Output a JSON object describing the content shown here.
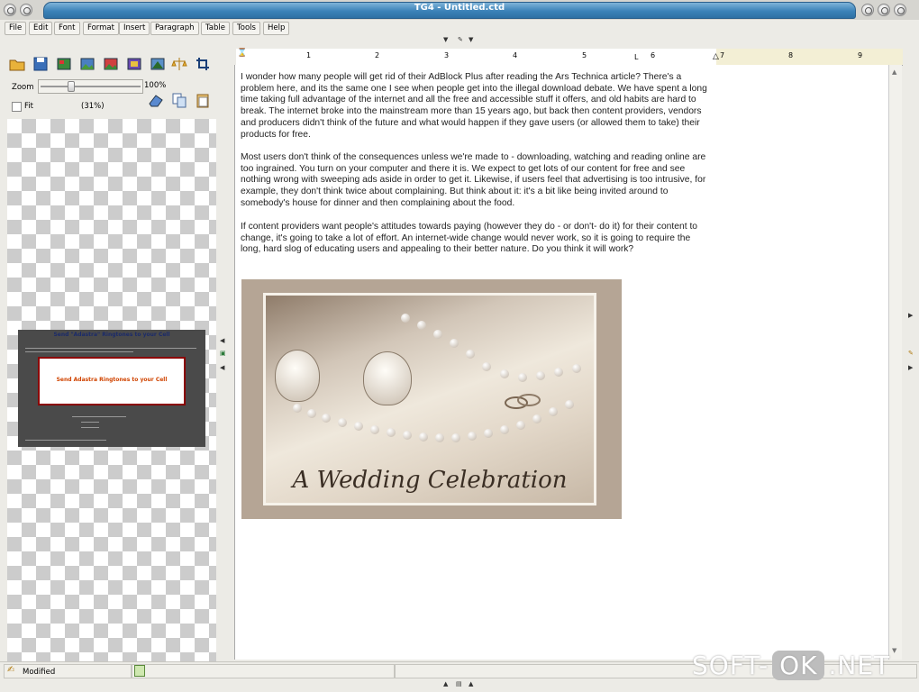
{
  "window": {
    "title": "TG4 - Untitled.ctd"
  },
  "menu": [
    "File",
    "Edit",
    "Font",
    "Format",
    "Insert",
    "Paragraph",
    "Table",
    "Tools",
    "Help"
  ],
  "left_panel": {
    "zoom_label": "Zoom",
    "zoom_max": "100%",
    "fit_label": "Fit",
    "zoom_value": "(31%)",
    "preview": {
      "title": "Send \"Adastra\" Ringtones to your Cell",
      "box_text": "Send Adastra Ringtones to your Cell"
    }
  },
  "ruler": {
    "numbers": [
      "1",
      "2",
      "3",
      "4",
      "5",
      "6",
      "7",
      "8",
      "9"
    ]
  },
  "document": {
    "paragraphs": [
      "I wonder how many people will get rid of their AdBlock Plus after reading the Ars Technica article? There's a problem here, and its the same one I see when people get into the illegal download debate. We have spent a long time taking full advantage of the internet and all the free and accessible stuff it offers, and old habits are hard to break. The internet broke into the mainstream more than 15 years ago, but back then content providers, vendors and producers didn't think of the future and what would happen if they gave users (or allowed them to take) their products for free.",
      "Most users don't think of the consequences unless we're made to - downloading, watching and reading online are too ingrained. You turn on your computer and there it is. We expect to get lots of our content for free and see nothing wrong with sweeping ads aside in order to get it. Likewise, if users feel that advertising is too intrusive, for example, they don't think twice about complaining. But think about it: it's a bit like being invited around to somebody's house for dinner and then complaining about the food.",
      "If content providers want people's attitudes towards paying (however they do - or don't- do it) for their content to change, it's going to take a lot of effort. An internet-wide change would never work, so it is going to require the long, hard slog of educating users and appealing to their better nature. Do you think it will work?"
    ],
    "image_caption": "A Wedding Celebration"
  },
  "status": {
    "text": "Modified"
  },
  "watermark": {
    "part1": "SOFT-",
    "part2": "OK",
    "part3": ".NET"
  },
  "icons": [
    "open-folder-icon",
    "save-icon",
    "image-icon",
    "image-icon",
    "image-icon",
    "image-icon",
    "image-icon",
    "scale-icon",
    "crop-icon",
    "eraser-icon",
    "copy-icon",
    "paste-icon"
  ]
}
